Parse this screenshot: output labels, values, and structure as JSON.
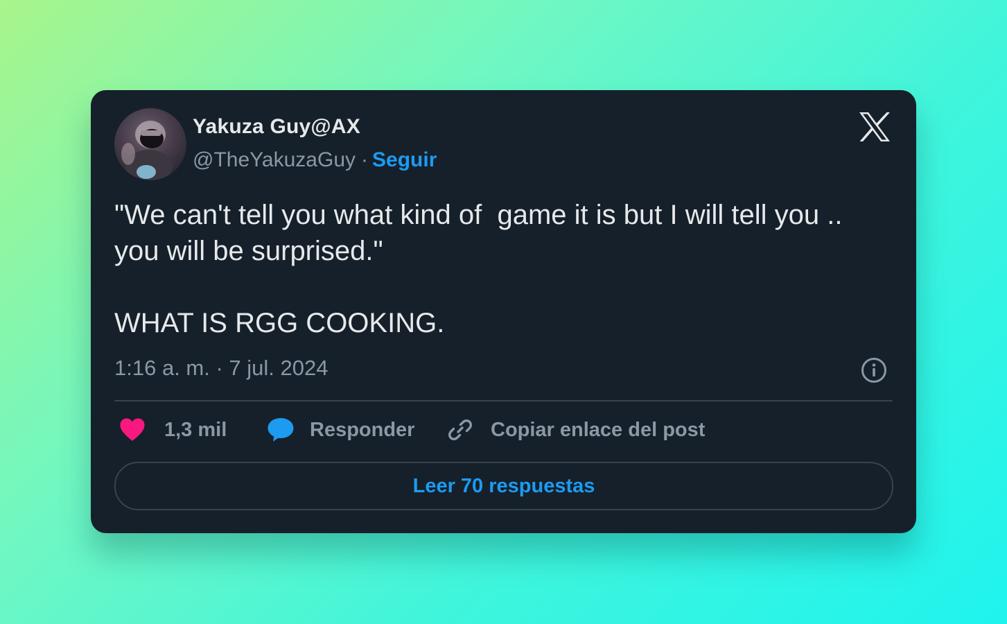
{
  "author": {
    "display_name": "Yakuza Guy@AX",
    "handle": "@TheYakuzaGuy",
    "separator": "·",
    "follow_label": "Seguir"
  },
  "tweet": {
    "text": "\"We can't tell you what kind of  game it is but I will tell you .. you will be surprised.\"\n\nWHAT IS RGG COOKING.",
    "timestamp": "1:16 a. m. · 7 jul. 2024"
  },
  "actions": {
    "likes": "1,3 mil",
    "reply_label": "Responder",
    "copy_link_label": "Copiar enlace del post"
  },
  "read_replies_label": "Leer 70 respuestas",
  "icons": {
    "logo": "x-logo-icon",
    "info": "info-icon",
    "like": "heart-icon",
    "reply": "speech-bubble-icon",
    "copy": "link-icon"
  },
  "colors": {
    "card_background": "#15202b",
    "accent": "#1d9bf0",
    "like": "#f91880",
    "primary_text": "#e7e9ea",
    "secondary_text": "#8b98a5",
    "border": "#38444d"
  }
}
